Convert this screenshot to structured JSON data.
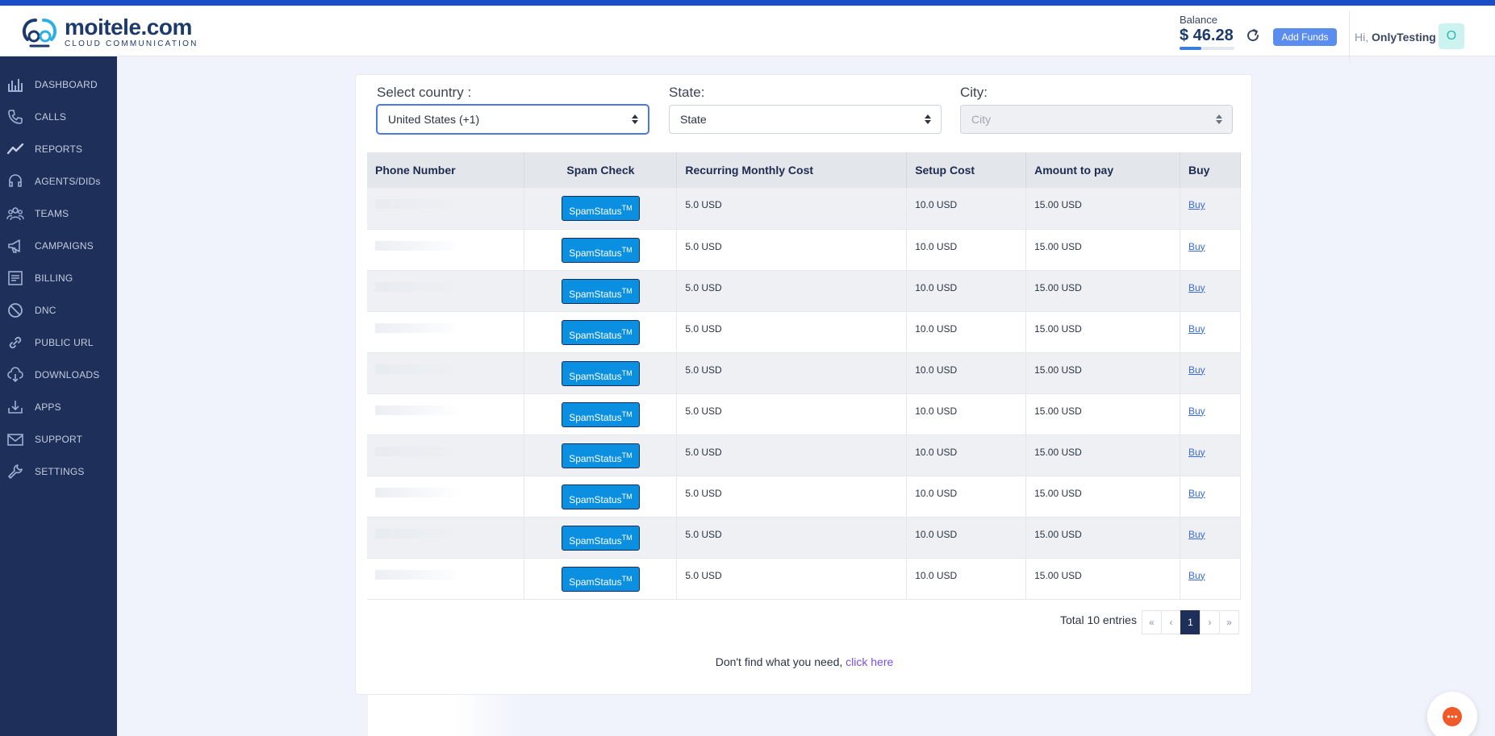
{
  "brand": {
    "name": "moitele.com",
    "tagline": "CLOUD COMMUNICATION"
  },
  "header": {
    "balance_label": "Balance",
    "balance_value": "$ 46.28",
    "balance_progress": 0.4,
    "add_funds_label": "Add Funds",
    "greeting_prefix": "Hi, ",
    "user_name": "OnlyTesting",
    "avatar_initial": "O"
  },
  "sidebar": {
    "items": [
      {
        "label": "DASHBOARD",
        "icon": "dashboard-icon"
      },
      {
        "label": "CALLS",
        "icon": "phone-icon"
      },
      {
        "label": "REPORTS",
        "icon": "trend-icon"
      },
      {
        "label": "AGENTS/DIDs",
        "icon": "headset-icon"
      },
      {
        "label": "TEAMS",
        "icon": "team-icon"
      },
      {
        "label": "CAMPAIGNS",
        "icon": "megaphone-icon"
      },
      {
        "label": "BILLING",
        "icon": "invoice-icon"
      },
      {
        "label": "DNC",
        "icon": "block-icon"
      },
      {
        "label": "PUBLIC URL",
        "icon": "link-icon"
      },
      {
        "label": "DOWNLOADS",
        "icon": "cloud-download-icon"
      },
      {
        "label": "APPS",
        "icon": "app-download-icon"
      },
      {
        "label": "SUPPORT",
        "icon": "mail-icon"
      },
      {
        "label": "SETTINGS",
        "icon": "wrench-icon"
      }
    ]
  },
  "filters": {
    "country_label": "Select country :",
    "country_value": "United States (+1)",
    "state_label": "State:",
    "state_value": "State",
    "city_label": "City:",
    "city_value": "City"
  },
  "table": {
    "headers": [
      "Phone Number",
      "Spam Check",
      "Recurring Monthly Cost",
      "Setup Cost",
      "Amount to pay",
      "Buy"
    ],
    "spam_button_label": "SpamStatus",
    "spam_button_tm": "TM",
    "rows": [
      {
        "monthly": "5.0 USD",
        "setup": "10.0 USD",
        "amount": "15.00 USD",
        "buy": "Buy"
      },
      {
        "monthly": "5.0 USD",
        "setup": "10.0 USD",
        "amount": "15.00 USD",
        "buy": "Buy"
      },
      {
        "monthly": "5.0 USD",
        "setup": "10.0 USD",
        "amount": "15.00 USD",
        "buy": "Buy"
      },
      {
        "monthly": "5.0 USD",
        "setup": "10.0 USD",
        "amount": "15.00 USD",
        "buy": "Buy"
      },
      {
        "monthly": "5.0 USD",
        "setup": "10.0 USD",
        "amount": "15.00 USD",
        "buy": "Buy"
      },
      {
        "monthly": "5.0 USD",
        "setup": "10.0 USD",
        "amount": "15.00 USD",
        "buy": "Buy"
      },
      {
        "monthly": "5.0 USD",
        "setup": "10.0 USD",
        "amount": "15.00 USD",
        "buy": "Buy"
      },
      {
        "monthly": "5.0 USD",
        "setup": "10.0 USD",
        "amount": "15.00 USD",
        "buy": "Buy"
      },
      {
        "monthly": "5.0 USD",
        "setup": "10.0 USD",
        "amount": "15.00 USD",
        "buy": "Buy"
      },
      {
        "monthly": "5.0 USD",
        "setup": "10.0 USD",
        "amount": "15.00 USD",
        "buy": "Buy"
      }
    ]
  },
  "pagination": {
    "total_text": "Total 10 entries",
    "first": "«",
    "prev": "‹",
    "current": "1",
    "next": "›",
    "last": "»"
  },
  "footer": {
    "note": "Don't find what you need, ",
    "link": "click here"
  }
}
